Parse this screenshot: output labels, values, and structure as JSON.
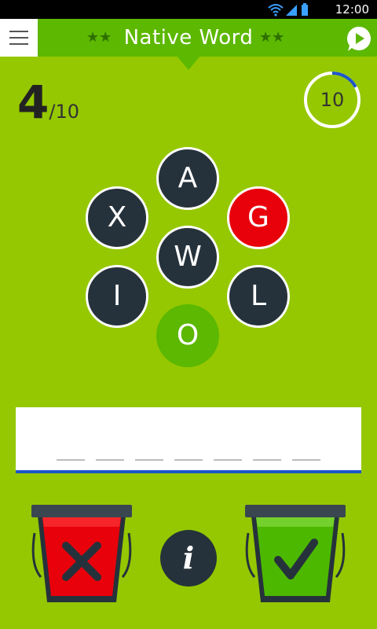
{
  "status_bar": {
    "time": "12:00"
  },
  "header": {
    "title": "Native Word",
    "stars_left": "★★",
    "stars_right": "★★"
  },
  "progress": {
    "current": "4",
    "total": "/10"
  },
  "timer": {
    "value": "10",
    "remaining_fraction": 0.17
  },
  "letters": [
    {
      "char": "A",
      "state": "default"
    },
    {
      "char": "X",
      "state": "default"
    },
    {
      "char": "G",
      "state": "wrong"
    },
    {
      "char": "W",
      "state": "default"
    },
    {
      "char": "I",
      "state": "default"
    },
    {
      "char": "L",
      "state": "default"
    },
    {
      "char": "O",
      "state": "used"
    }
  ],
  "answer": {
    "slot_count": 7
  },
  "actions": {
    "reject_icon": "x-icon",
    "accept_icon": "check-icon",
    "info_icon": "info-icon",
    "info_label": "i"
  },
  "colors": {
    "background": "#95c800",
    "header": "#5cb800",
    "tile": "#26323b",
    "wrong": "#e8000b",
    "used": "#5cb800",
    "underline": "#1e56c8"
  }
}
